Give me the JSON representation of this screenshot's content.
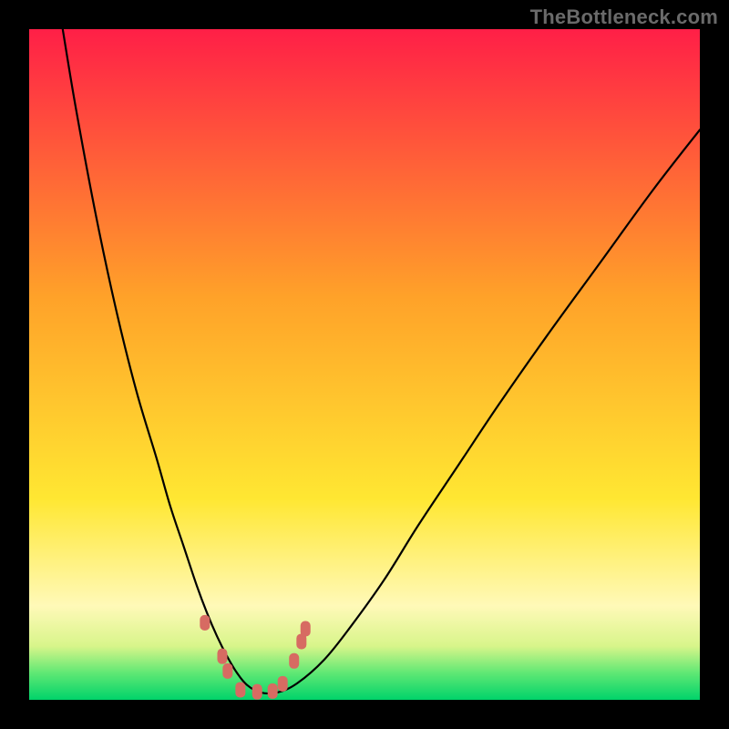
{
  "watermark": "TheBottleneck.com",
  "colors": {
    "red": "#ff1f47",
    "orange": "#ffa229",
    "yellow": "#ffe732",
    "yellow_pale": "#fff9b8",
    "green_light": "#5fe874",
    "green": "#00d36a",
    "curve": "#000000",
    "marker": "#d76b62",
    "frame": "#000000"
  },
  "chart_data": {
    "type": "line",
    "title": "",
    "xlabel": "",
    "ylabel": "",
    "xlim": [
      0,
      100
    ],
    "ylim": [
      0,
      100
    ],
    "series": [
      {
        "name": "bottleneck-curve",
        "x": [
          5,
          7,
          10,
          13,
          16,
          19,
          21,
          23,
          25,
          26.5,
          28,
          29.5,
          31,
          32.5,
          34.5,
          37,
          40,
          44,
          48,
          53,
          58,
          64,
          70,
          77,
          85,
          93,
          100
        ],
        "values": [
          100,
          88,
          72,
          58,
          46,
          36,
          29,
          23,
          17,
          13,
          9.5,
          6.5,
          4,
          2.2,
          1.1,
          1.1,
          2.5,
          6,
          11,
          18,
          26,
          35,
          44,
          54,
          65,
          76,
          85
        ]
      }
    ],
    "markers": [
      {
        "x": 26.2,
        "y": 11.5
      },
      {
        "x": 28.8,
        "y": 6.5
      },
      {
        "x": 29.6,
        "y": 4.3
      },
      {
        "x": 31.5,
        "y": 1.5
      },
      {
        "x": 34.0,
        "y": 1.2
      },
      {
        "x": 36.3,
        "y": 1.3
      },
      {
        "x": 37.8,
        "y": 2.4
      },
      {
        "x": 39.5,
        "y": 5.8
      },
      {
        "x": 40.6,
        "y": 8.7
      },
      {
        "x": 41.2,
        "y": 10.6
      }
    ],
    "gradient_stops": [
      {
        "offset": 0.0,
        "color": "#ff1f47"
      },
      {
        "offset": 0.4,
        "color": "#ffa229"
      },
      {
        "offset": 0.7,
        "color": "#ffe732"
      },
      {
        "offset": 0.86,
        "color": "#fff9b8"
      },
      {
        "offset": 0.92,
        "color": "#d8f58a"
      },
      {
        "offset": 0.96,
        "color": "#5fe874"
      },
      {
        "offset": 1.0,
        "color": "#00d36a"
      }
    ]
  }
}
